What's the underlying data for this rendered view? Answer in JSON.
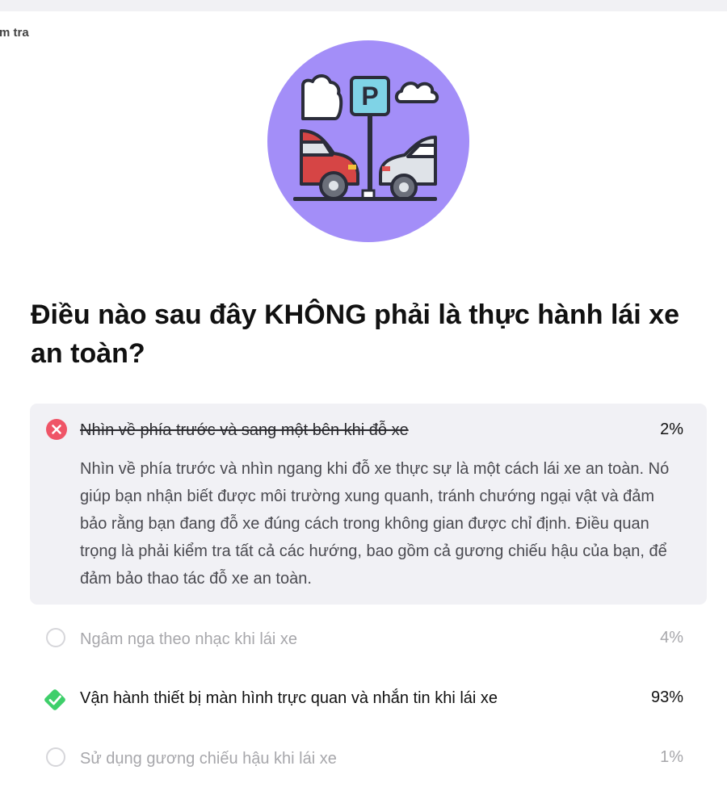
{
  "breadcrumb": "m tra",
  "question": "Điều nào sau đây KHÔNG phải là thực hành lái xe an toàn?",
  "colors": {
    "hero_bg": "#a38ef8",
    "wrong": "#ef5567",
    "correct": "#3ecf6a",
    "selected_bg": "#f1f1f5"
  },
  "options": [
    {
      "label": "Nhìn về phía trước và sang một bên khi đỗ xe",
      "percent": "2%",
      "state": "wrong",
      "icon": "x-circle-icon",
      "explanation": "Nhìn về phía trước và nhìn ngang khi đỗ xe thực sự là một cách lái xe an toàn. Nó giúp bạn nhận biết được môi trường xung quanh, tránh chướng ngại vật và đảm bảo rằng bạn đang đỗ xe đúng cách trong không gian được chỉ định. Điều quan trọng là phải kiểm tra tất cả các hướng, bao gồm cả gương chiếu hậu của bạn, để đảm bảo thao tác đỗ xe an toàn."
    },
    {
      "label": "Ngâm nga theo nhạc khi lái xe",
      "percent": "4%",
      "state": "unselected",
      "icon": "radio-empty-icon"
    },
    {
      "label": "Vận hành thiết bị màn hình trực quan và nhắn tin khi lái xe",
      "percent": "93%",
      "state": "correct",
      "icon": "check-diamond-icon"
    },
    {
      "label": "Sử dụng gương chiếu hậu khi lái xe",
      "percent": "1%",
      "state": "unselected",
      "icon": "radio-empty-icon"
    }
  ],
  "hero": {
    "sign_letter": "P",
    "icon": "parking-cars-illustration-icon"
  }
}
